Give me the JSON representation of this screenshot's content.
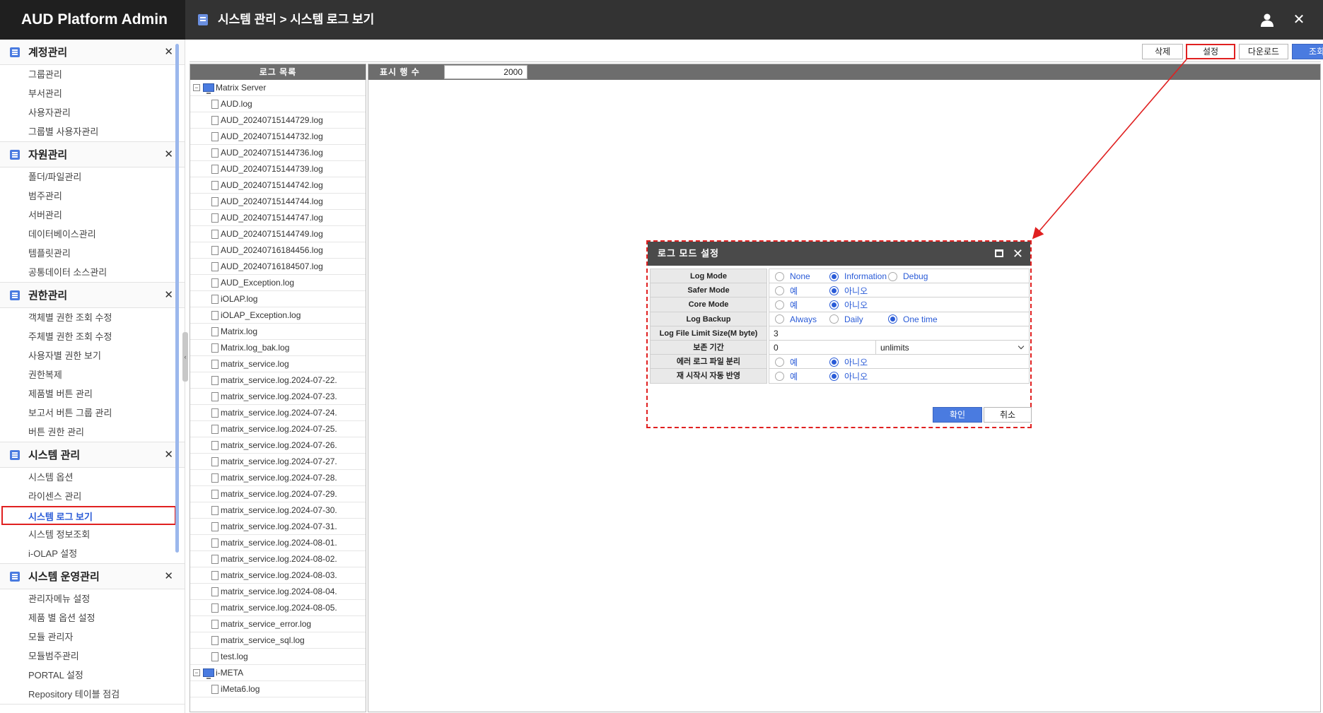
{
  "app": {
    "title": "AUD Platform Admin"
  },
  "header": {
    "breadcrumb": "시스템 관리 > 시스템 로그 보기",
    "icons": [
      "user-icon",
      "close-icon"
    ]
  },
  "sidebar": {
    "sections": [
      {
        "title": "계정관리",
        "items": [
          "그룹관리",
          "부서관리",
          "사용자관리",
          "그룹별 사용자관리"
        ]
      },
      {
        "title": "자원관리",
        "items": [
          "폴더/파일관리",
          "범주관리",
          "서버관리",
          "데이터베이스관리",
          "템플릿관리",
          "공통데이터 소스관리"
        ]
      },
      {
        "title": "권한관리",
        "items": [
          "객체별 권한 조회 수정",
          "주체별 권한 조회 수정",
          "사용자별 권한 보기",
          "권한복제",
          "제품별 버튼 관리",
          "보고서 버튼 그룹 관리",
          "버튼 권한 관리"
        ]
      },
      {
        "title": "시스템 관리",
        "items": [
          "시스템 옵션",
          "라이센스 관리",
          "시스템 로그 보기",
          "시스템 정보조회",
          "i-OLAP 설정"
        ]
      },
      {
        "title": "시스템 운영관리",
        "items": [
          "관리자메뉴 설정",
          "제품 별 옵션 설정",
          "모듈 관리자",
          "모듈범주관리",
          "PORTAL 설정",
          "Repository 테이블 점검"
        ]
      }
    ],
    "active_item": "시스템 로그 보기"
  },
  "toolbar": {
    "delete_label": "삭제",
    "settings_label": "설정",
    "download_label": "다운로드",
    "search_label": "조회"
  },
  "log_list": {
    "header": "로그 목록",
    "roots": [
      {
        "name": "Matrix Server",
        "files": [
          "AUD.log",
          "AUD_20240715144729.log",
          "AUD_20240715144732.log",
          "AUD_20240715144736.log",
          "AUD_20240715144739.log",
          "AUD_20240715144742.log",
          "AUD_20240715144744.log",
          "AUD_20240715144747.log",
          "AUD_20240715144749.log",
          "AUD_20240716184456.log",
          "AUD_20240716184507.log",
          "AUD_Exception.log",
          "iOLAP.log",
          "iOLAP_Exception.log",
          "Matrix.log",
          "Matrix.log_bak.log",
          "matrix_service.log",
          "matrix_service.log.2024-07-22.",
          "matrix_service.log.2024-07-23.",
          "matrix_service.log.2024-07-24.",
          "matrix_service.log.2024-07-25.",
          "matrix_service.log.2024-07-26.",
          "matrix_service.log.2024-07-27.",
          "matrix_service.log.2024-07-28.",
          "matrix_service.log.2024-07-29.",
          "matrix_service.log.2024-07-30.",
          "matrix_service.log.2024-07-31.",
          "matrix_service.log.2024-08-01.",
          "matrix_service.log.2024-08-02.",
          "matrix_service.log.2024-08-03.",
          "matrix_service.log.2024-08-04.",
          "matrix_service.log.2024-08-05.",
          "matrix_service_error.log",
          "matrix_service_sql.log",
          "test.log"
        ]
      },
      {
        "name": "i-META",
        "files": [
          "iMeta6.log"
        ]
      }
    ]
  },
  "viewer": {
    "rows_label": "표시 행 수",
    "rows_value": "2000"
  },
  "dialog": {
    "title": "로그 모드 설정",
    "rows": [
      {
        "label": "Log Mode",
        "options": [
          "None",
          "Information",
          "Debug"
        ],
        "selected": "Information"
      },
      {
        "label": "Safer Mode",
        "options": [
          "예",
          "아니오"
        ],
        "selected": "아니오"
      },
      {
        "label": "Core Mode",
        "options": [
          "예",
          "아니오"
        ],
        "selected": "아니오"
      },
      {
        "label": "Log Backup",
        "options": [
          "Always",
          "Daily",
          "One time"
        ],
        "selected": "One time"
      },
      {
        "label": "Log File Limit Size(M byte)",
        "value": "3"
      },
      {
        "label": "보존 기간",
        "value": "0",
        "select_value": "unlimits"
      },
      {
        "label": "에러 로그 파일 분리",
        "options": [
          "예",
          "아니오"
        ],
        "selected": "아니오"
      },
      {
        "label": "재 시작시 자동 반영",
        "options": [
          "예",
          "아니오"
        ],
        "selected": "아니오"
      }
    ],
    "ok_label": "확인",
    "cancel_label": "취소"
  },
  "colors": {
    "accent": "#4a7be0",
    "header_bg": "#333333",
    "highlight": "#e02020"
  }
}
